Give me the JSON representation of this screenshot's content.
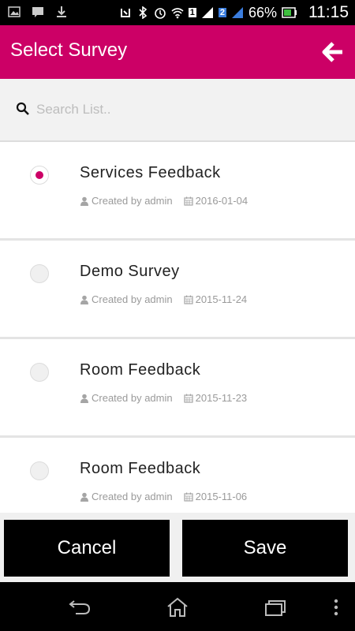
{
  "status_bar": {
    "battery": "66%",
    "time": "11:15",
    "sim1": "1",
    "sim2": "2"
  },
  "app_bar": {
    "title": "Select Survey"
  },
  "search": {
    "placeholder": "Search List.."
  },
  "surveys": [
    {
      "name": "Services Feedback",
      "created_by": "Created by admin",
      "date": "2016-01-04",
      "selected": true
    },
    {
      "name": "Demo Survey",
      "created_by": "Created by admin",
      "date": "2015-11-24",
      "selected": false
    },
    {
      "name": "Room Feedback",
      "created_by": "Created by admin",
      "date": "2015-11-23",
      "selected": false
    },
    {
      "name": "Room Feedback",
      "created_by": "Created by admin",
      "date": "2015-11-06",
      "selected": false
    }
  ],
  "footer": {
    "cancel_label": "Cancel",
    "save_label": "Save"
  },
  "colors": {
    "accent": "#cc0066"
  }
}
